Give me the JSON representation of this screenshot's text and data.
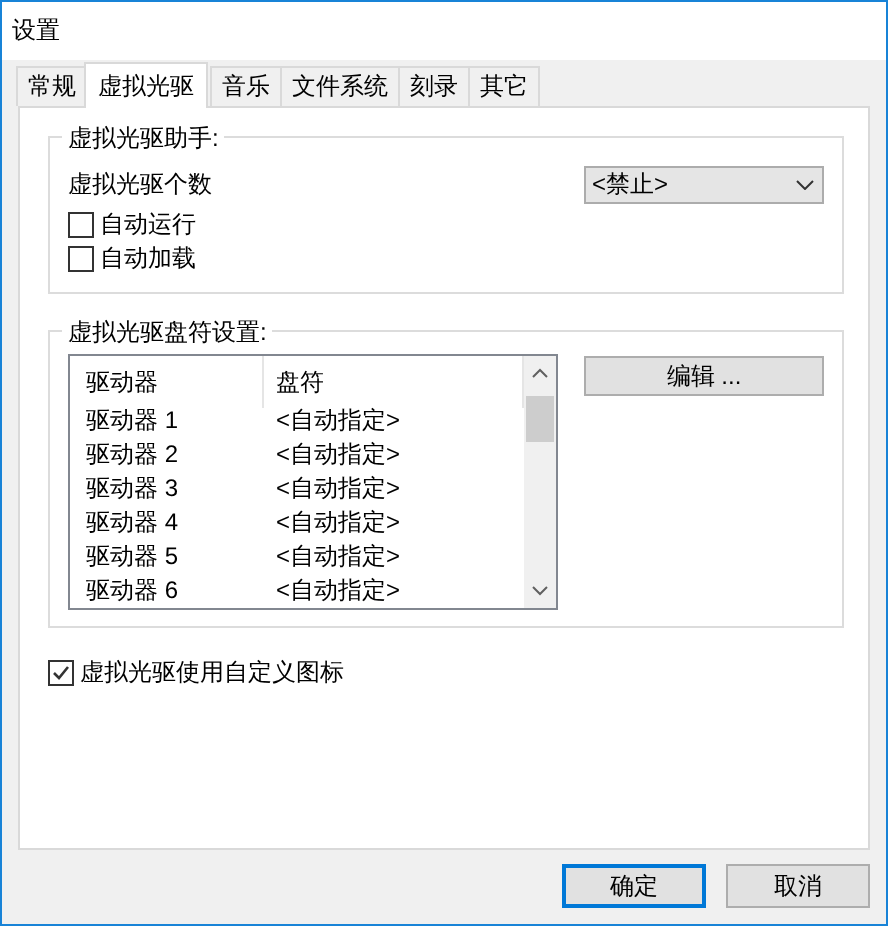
{
  "window": {
    "title": "设置"
  },
  "tabs": [
    {
      "label": "常规",
      "selected": false
    },
    {
      "label": "虚拟光驱",
      "selected": true
    },
    {
      "label": "音乐",
      "selected": false
    },
    {
      "label": "文件系统",
      "selected": false
    },
    {
      "label": "刻录",
      "selected": false
    },
    {
      "label": "其它",
      "selected": false
    }
  ],
  "assistant_group": {
    "title": "虚拟光驱助手:",
    "count_label": "虚拟光驱个数",
    "count_value": "<禁止>",
    "checkboxes": [
      {
        "label": "自动运行",
        "checked": false
      },
      {
        "label": "自动加载",
        "checked": false
      }
    ]
  },
  "drive_letter_group": {
    "title": "虚拟光驱盘符设置:",
    "columns": [
      "驱动器",
      "盘符"
    ],
    "rows": [
      [
        "驱动器 1",
        "<自动指定>"
      ],
      [
        "驱动器 2",
        "<自动指定>"
      ],
      [
        "驱动器 3",
        "<自动指定>"
      ],
      [
        "驱动器 4",
        "<自动指定>"
      ],
      [
        "驱动器 5",
        "<自动指定>"
      ],
      [
        "驱动器 6",
        "<自动指定>"
      ]
    ],
    "edit_button": "编辑 ..."
  },
  "custom_icon": {
    "label": "虚拟光驱使用自定义图标",
    "checked": true
  },
  "buttons": [
    {
      "label": "确定",
      "default": true
    },
    {
      "label": "取消",
      "default": false
    }
  ]
}
